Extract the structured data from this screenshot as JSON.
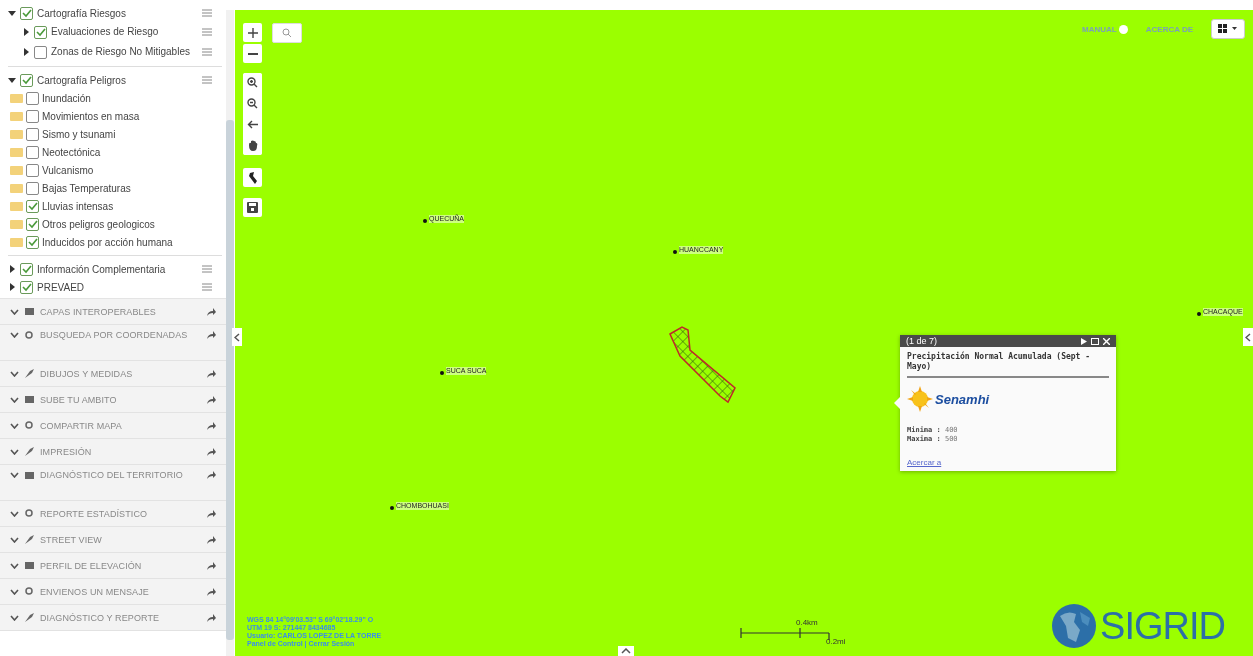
{
  "layers": [
    {
      "label": "Cartografía Riesgos",
      "checked": true,
      "expanded": true,
      "children": [
        {
          "label": "Evaluaciones de Riesgo",
          "checked": true,
          "expanded": false
        },
        {
          "label": "Zonas de Riesgo No Mitigables",
          "checked": false,
          "expanded": false
        }
      ]
    },
    {
      "label": "Cartografía Peligros",
      "checked": true,
      "expanded": true,
      "children": [
        {
          "label": "Inundación",
          "checked": false,
          "kind": "folder"
        },
        {
          "label": "Movimientos en masa",
          "checked": false,
          "kind": "folder"
        },
        {
          "label": "Sismo y tsunami",
          "checked": false,
          "kind": "folder"
        },
        {
          "label": "Neotectónica",
          "checked": false,
          "kind": "folder"
        },
        {
          "label": "Vulcanismo",
          "checked": false,
          "kind": "folder"
        },
        {
          "label": "Bajas Temperaturas",
          "checked": false,
          "kind": "folder"
        },
        {
          "label": "Lluvias intensas",
          "checked": true,
          "kind": "folder"
        },
        {
          "label": "Otros peligros geologicos",
          "checked": true,
          "kind": "folder"
        },
        {
          "label": "Inducidos por acción humana",
          "checked": true,
          "kind": "folder"
        }
      ]
    },
    {
      "label": "Información Complementaria",
      "checked": true,
      "expanded": false
    },
    {
      "label": "PREVAED",
      "checked": true,
      "expanded": false
    }
  ],
  "sections": [
    {
      "label": "CAPAS INTEROPERABLES"
    },
    {
      "label": "BUSQUEDA POR COORDENADAS"
    },
    {
      "label": "DIBUJOS Y MEDIDAS"
    },
    {
      "label": "SUBE TU AMBITO"
    },
    {
      "label": "COMPARTIR MAPA"
    },
    {
      "label": "IMPRESIÓN"
    },
    {
      "label": "DIAGNÓSTICO DEL TERRITORIO"
    },
    {
      "label": "REPORTE ESTADÍSTICO"
    },
    {
      "label": "STREET VIEW"
    },
    {
      "label": "PERFIL DE ELEVACIÓN"
    },
    {
      "label": "ENVIENOS UN MENSAJE"
    },
    {
      "label": "DIAGNÓSTICO Y REPORTE"
    }
  ],
  "top_links": [
    "MANUAL",
    "ACERCA DE"
  ],
  "places": [
    {
      "name": "QUECUÑA"
    },
    {
      "name": "HUANCCANY"
    },
    {
      "name": "SUCA SUCA"
    },
    {
      "name": "CHOMBOHUASI"
    },
    {
      "name": "CHACAQUE"
    }
  ],
  "popup": {
    "counter": "(1 de 7)",
    "title": "Precipitación Normal Acumulada (Sept - Mayo)",
    "logo": "Senamhi",
    "fields": [
      {
        "label": "Minima :",
        "value": "400"
      },
      {
        "label": "Maxima :",
        "value": "500"
      }
    ],
    "link": "Acercar a"
  },
  "coordinates": [
    "WGS 84   14°09'03.53\" S  69°02'18.29\" O",
    "UTM 19 S: 271447  8434685",
    "Usuario: CARLOS LOPEZ DE LA TORRE",
    "Panel de Control  |  Cerrar Sesión"
  ],
  "scale": [
    "0.4km",
    "0.2mi"
  ],
  "brand": "SIGRID"
}
